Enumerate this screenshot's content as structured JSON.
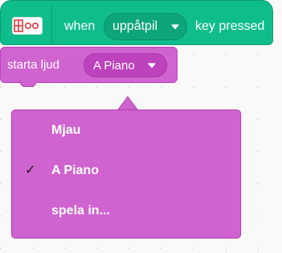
{
  "hat_block": {
    "extension_icon": "makey-makey-icon",
    "when_label": "when",
    "key_value": "uppåtpil",
    "dropdown_icon": "caret-down-icon",
    "suffix_label": "key pressed",
    "color": "#0fbd8c"
  },
  "sound_block": {
    "label": "starta ljud",
    "sound_value": "A Piano",
    "dropdown_icon": "caret-down-icon",
    "color": "#cf63cf"
  },
  "dropdown_menu": {
    "items": [
      {
        "label": "Mjau",
        "selected": false
      },
      {
        "label": "A Piano",
        "selected": true,
        "check": "✓"
      },
      {
        "label": "spela in...",
        "selected": false
      }
    ]
  }
}
